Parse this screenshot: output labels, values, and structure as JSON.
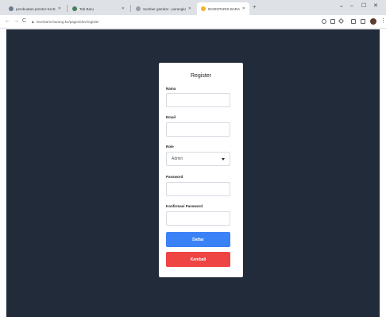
{
  "browser": {
    "tabs": [
      {
        "title": "pembuatan-prenter-tra-EP-4.0-bo",
        "favicon_color": "#6b7a8f"
      },
      {
        "title": "Tab Baru",
        "favicon_color": "#4a7c59"
      },
      {
        "title": "Sumber gambar - perangkat-e-dara-t",
        "favicon_color": "#9aa0a6"
      },
      {
        "title": "INVENTARIS BARANG",
        "favicon_color": "#f2b233"
      }
    ],
    "new_tab": "+",
    "window_controls": {
      "minimize": "–",
      "maximize": "☐",
      "close": "✕"
    },
    "url": "inventaris-barang.ku/pages/dev/register",
    "nav": {
      "back": "←",
      "forward": "→",
      "reload": "C"
    },
    "menu": "⋮"
  },
  "form": {
    "title": "Register",
    "fields": {
      "nama_label": "Nama",
      "email_label": "Email",
      "role_label": "Role",
      "role_value": "Admin",
      "password_label": "Password",
      "confirm_label": "Konfirmasi Password"
    },
    "submit_label": "Daftar",
    "back_label": "Kembali"
  },
  "colors": {
    "page_background": "#212b3a",
    "submit_button": "#3b82f6",
    "back_button": "#ef4444"
  }
}
